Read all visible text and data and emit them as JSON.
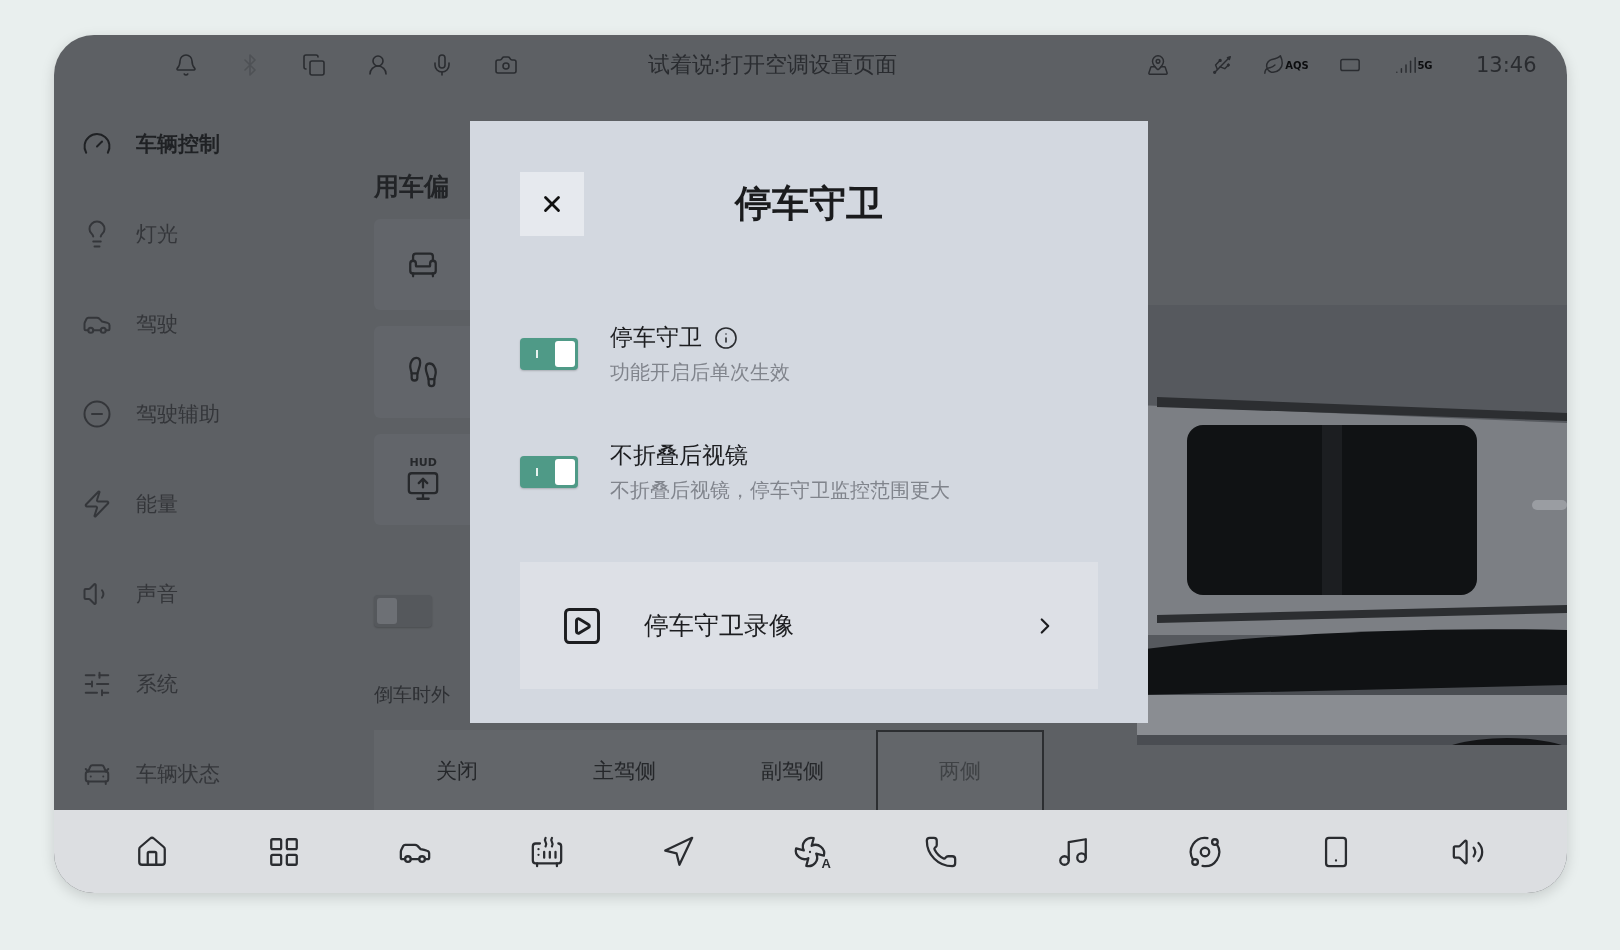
{
  "status_bar": {
    "left_icons": [
      {
        "kind": "bell",
        "disabled": false
      },
      {
        "kind": "bluetooth",
        "disabled": true
      },
      {
        "kind": "mirror",
        "disabled": false
      },
      {
        "kind": "person",
        "disabled": false
      },
      {
        "kind": "mic",
        "disabled": false
      },
      {
        "kind": "camera",
        "disabled": false
      }
    ],
    "voice_hint": "试着说:打开空调设置页面",
    "right_icons": [
      {
        "kind": "pin"
      },
      {
        "kind": "usb"
      },
      {
        "kind": "aqs",
        "label": "AQS"
      },
      {
        "kind": "battery"
      },
      {
        "kind": "signal",
        "label": "5G"
      }
    ],
    "time": "13:46"
  },
  "sidebar": {
    "items": [
      {
        "label": "车辆控制",
        "selected": true
      },
      {
        "label": "灯光",
        "selected": false
      },
      {
        "label": "驾驶",
        "selected": false
      },
      {
        "label": "驾驶辅助",
        "selected": false
      },
      {
        "label": "能量",
        "selected": false
      },
      {
        "label": "声音",
        "selected": false
      },
      {
        "label": "系统",
        "selected": false
      },
      {
        "label": "车辆状态",
        "selected": false
      }
    ]
  },
  "content": {
    "section_title": "用车偏",
    "settings": [
      {
        "kind": "plain"
      },
      {
        "kind": "plain"
      },
      {
        "kind": "labeled",
        "label": "HUD"
      }
    ],
    "partial_toggle": {
      "on": false
    },
    "mirror_caption": "倒车时外",
    "segments": [
      {
        "label": "关闭",
        "selected": false
      },
      {
        "label": "主驾侧",
        "selected": false
      },
      {
        "label": "副驾侧",
        "selected": false
      },
      {
        "label": "两侧",
        "selected": true
      }
    ]
  },
  "dialog": {
    "title": "停车守卫",
    "toggles": [
      {
        "title": "停车守卫",
        "info": true,
        "subtitle": "功能开启后单次生效",
        "on": true
      },
      {
        "title": "不折叠后视镜",
        "info": false,
        "subtitle": "不折叠后视镜，停车守卫监控范围更大",
        "on": true
      }
    ],
    "link": {
      "label": "停车守卫录像"
    }
  },
  "dock": {
    "items": [
      {
        "kind": "home"
      },
      {
        "kind": "apps"
      },
      {
        "kind": "car"
      },
      {
        "kind": "defrost"
      },
      {
        "kind": "navigation"
      },
      {
        "kind": "fan",
        "label": "A"
      },
      {
        "kind": "phone"
      },
      {
        "kind": "music"
      },
      {
        "kind": "planet"
      },
      {
        "kind": "cast"
      },
      {
        "kind": "volume"
      }
    ]
  }
}
